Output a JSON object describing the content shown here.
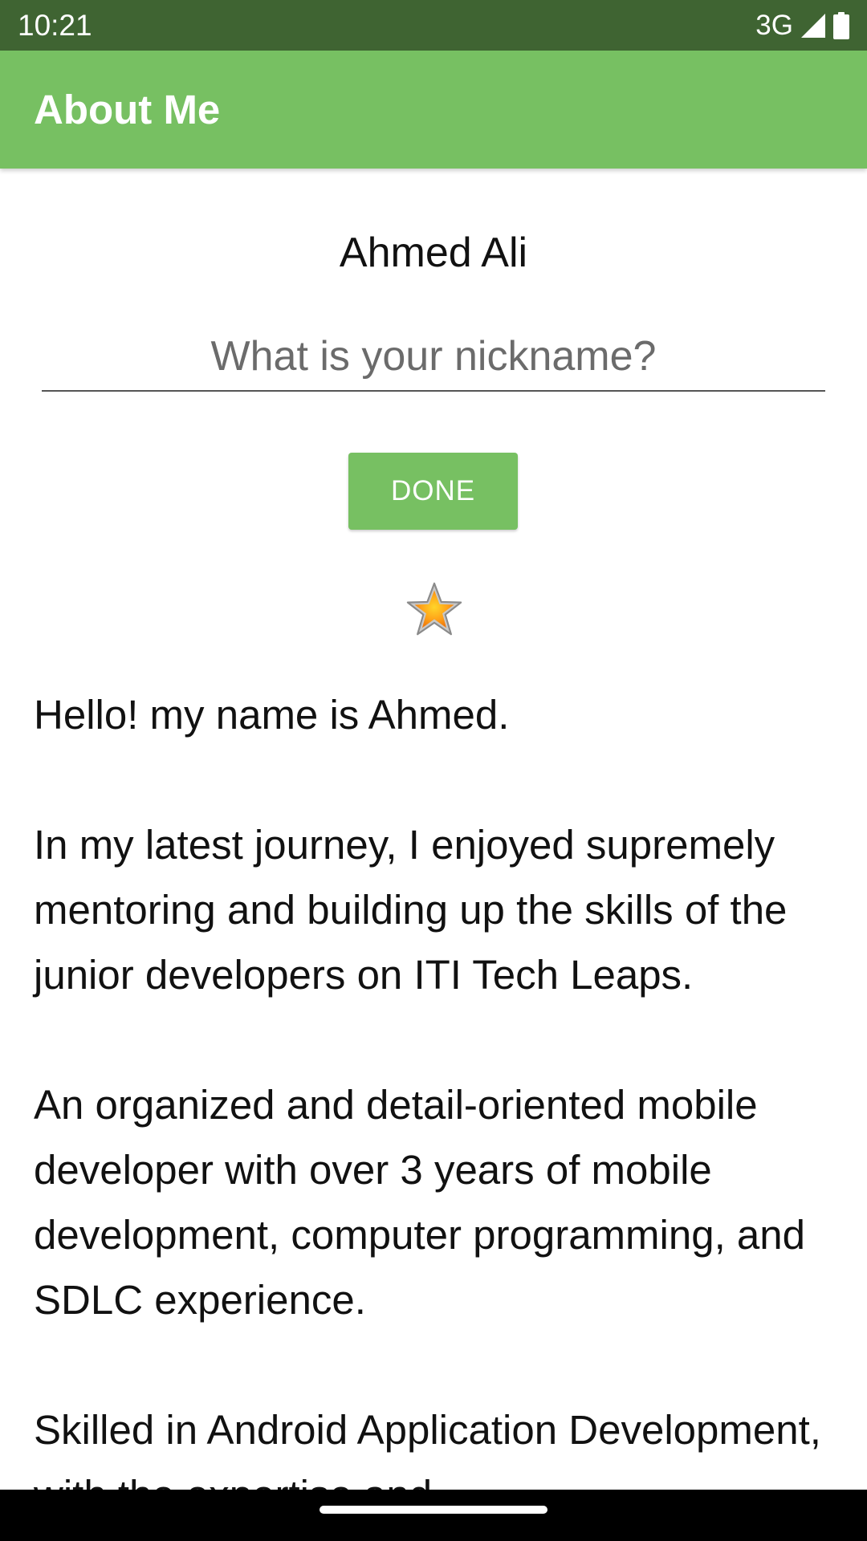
{
  "status_bar": {
    "time": "10:21",
    "network": "3G",
    "signal_icon": "signal-icon",
    "battery_icon": "battery-icon"
  },
  "app_bar": {
    "title": "About Me",
    "color": "#77c062"
  },
  "profile": {
    "name": "Ahmed Ali",
    "nickname": {
      "value": "",
      "placeholder": "What is your nickname?"
    },
    "done_label": "DONE",
    "star_icon": "star-icon",
    "bio": "Hello! my name is Ahmed.\n\nIn my latest journey, I enjoyed supremely mentoring and building up the skills of the junior developers on ITI Tech Leaps.\n\nAn organized and detail-oriented mobile developer with over 3 years of mobile development, computer programming, and SDLC experience.\n\nSkilled in Android Application Development, with the expertise and"
  },
  "colors": {
    "status_bar": "#3f6432",
    "accent": "#77c062"
  }
}
